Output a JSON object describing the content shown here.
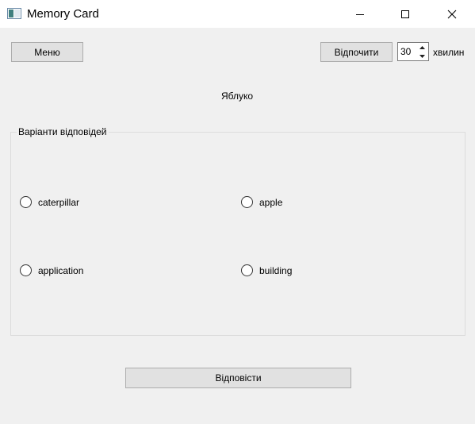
{
  "window": {
    "title": "Memory Card",
    "icons": [
      "app-icon",
      "minimize-icon",
      "maximize-icon",
      "close-icon"
    ]
  },
  "toolbar": {
    "menu_label": "Меню",
    "rest_label": "Відпочити",
    "minutes_value": "30",
    "minutes_unit": "хвилин"
  },
  "question": {
    "text": "Яблуко"
  },
  "answers": {
    "group_title": "Варіанти відповідей",
    "options": [
      "caterpillar",
      "apple",
      "application",
      "building"
    ]
  },
  "actions": {
    "answer_label": "Відповісти"
  }
}
